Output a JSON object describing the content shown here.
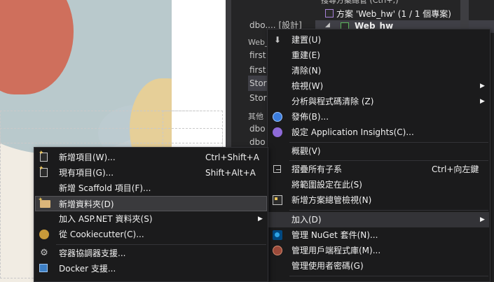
{
  "middle": {
    "design_item": "dbo.... [設計]",
    "group1": "Web_",
    "items1": [
      "first",
      "first",
      "Stor",
      "Stor"
    ],
    "group2": "其他",
    "items2": [
      "dbo",
      "dbo"
    ]
  },
  "solution_explorer": {
    "header": "搜尋方案總管 (Ctrl+;)",
    "solution_label": "方案 'Web_hw' (1 / 1 個專案)",
    "project_label": "Web_hw"
  },
  "project_menu": {
    "items": [
      {
        "label": "建置(U)",
        "icon": "build-icon"
      },
      {
        "label": "重建(E)"
      },
      {
        "label": "清除(N)"
      },
      {
        "label": "檢視(W)",
        "submenu": true
      },
      {
        "label": "分析與程式碼清除 (Z)",
        "submenu": true
      },
      {
        "label": "發佈(B)...",
        "icon": "globe-icon"
      },
      {
        "label": "設定 Application Insights(C)...",
        "icon": "insights-icon"
      },
      {
        "label": "概觀(V)"
      },
      {
        "label": "摺疊所有子系",
        "shortcut": "Ctrl+向左鍵",
        "icon": "collapse-icon"
      },
      {
        "label": "將範圍設定在此(S)"
      },
      {
        "label": "新增方案總管檢視(N)",
        "icon": "new-view-icon"
      },
      {
        "label": "加入(D)",
        "submenu": true
      },
      {
        "label": "管理 NuGet 套件(N)...",
        "icon": "nuget-icon"
      },
      {
        "label": "管理用戶端程式庫(M)...",
        "icon": "library-icon"
      },
      {
        "label": "管理使用者密碼(G)"
      }
    ]
  },
  "add_menu": {
    "items": [
      {
        "label": "新增項目(W)...",
        "shortcut": "Ctrl+Shift+A",
        "icon": "new-item-icon"
      },
      {
        "label": "現有項目(G)...",
        "shortcut": "Shift+Alt+A",
        "icon": "existing-item-icon"
      },
      {
        "label": "新增 Scaffold 項目(F)..."
      },
      {
        "label": "新增資料夾(D)",
        "icon": "new-folder-icon"
      },
      {
        "label": "加入 ASP.NET 資料夾(S)",
        "submenu": true
      },
      {
        "label": "從 Cookiecutter(C)...",
        "icon": "cookiecutter-icon"
      },
      {
        "label": "容器協調器支援...",
        "icon": "orchestrator-icon"
      },
      {
        "label": "Docker 支援...",
        "icon": "docker-icon"
      }
    ]
  },
  "colors": {
    "menu_bg": "#1b1b1c",
    "menu_highlight": "#333337",
    "text": "#f1f1f1",
    "ide_bg": "#2d2d30"
  }
}
